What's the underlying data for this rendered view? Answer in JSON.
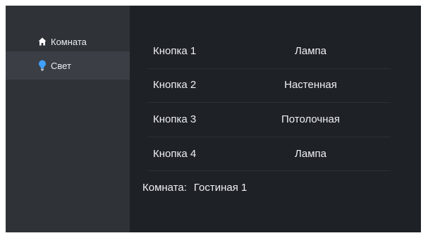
{
  "sidebar": {
    "items": [
      {
        "label": "Комната",
        "icon": "home-icon",
        "active": false
      },
      {
        "label": "Свет",
        "icon": "lightbulb-icon",
        "active": true
      }
    ]
  },
  "buttons": [
    {
      "button": "Кнопка 1",
      "device": "Лампа"
    },
    {
      "button": "Кнопка 2",
      "device": "Настенная"
    },
    {
      "button": "Кнопка 3",
      "device": "Потолочная"
    },
    {
      "button": "Кнопка 4",
      "device": "Лампа"
    }
  ],
  "room": {
    "label": "Комната:",
    "value": "Гостиная 1"
  },
  "colors": {
    "background": "#1e2126",
    "sidebar": "#2f3237",
    "active_item": "#3b3f45",
    "text": "#eef0f3",
    "bulb": "#3fa0ff"
  }
}
